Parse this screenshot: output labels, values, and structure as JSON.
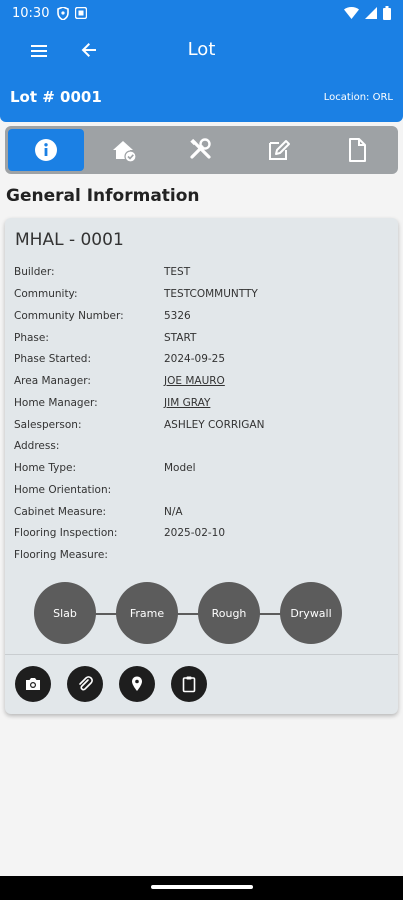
{
  "status_bar": {
    "time": "10:30"
  },
  "app_bar": {
    "title": "Lot"
  },
  "lot_header": {
    "lot_number": "Lot # 0001",
    "location": "Location: ORL"
  },
  "tabs": [
    {
      "icon": "info-icon",
      "active": true
    },
    {
      "icon": "home-check-icon",
      "active": false
    },
    {
      "icon": "tools-icon",
      "active": false
    },
    {
      "icon": "edit-icon",
      "active": false
    },
    {
      "icon": "document-icon",
      "active": false
    }
  ],
  "section": {
    "title": "General Information"
  },
  "card": {
    "title": "MHAL - 0001",
    "rows": [
      {
        "label": "Builder:",
        "value": "TEST"
      },
      {
        "label": "Community:",
        "value": "TESTCOMMUNTTY"
      },
      {
        "label": "Community Number:",
        "value": "5326"
      },
      {
        "label": "Phase:",
        "value": "START"
      },
      {
        "label": "Phase Started:",
        "value": "2024-09-25"
      },
      {
        "label": "Area Manager:",
        "value": "JOE MAURO"
      },
      {
        "label": "Home Manager:",
        "value": "JIM GRAY"
      },
      {
        "label": "Salesperson:",
        "value": "ASHLEY CORRIGAN"
      },
      {
        "label": "Address:",
        "value": ""
      },
      {
        "label": "Home Type:",
        "value": "Model"
      },
      {
        "label": "Home Orientation:",
        "value": ""
      },
      {
        "label": "Cabinet Measure:",
        "value": "N/A"
      },
      {
        "label": "Flooring Inspection:",
        "value": "2025-02-10"
      },
      {
        "label": "Flooring Measure:",
        "value": ""
      }
    ],
    "stages": [
      "Slab",
      "Frame",
      "Rough",
      "Drywall"
    ],
    "actions": [
      "camera-icon",
      "paperclip-icon",
      "location-pin-icon",
      "clipboard-icon"
    ]
  },
  "colors": {
    "primary": "#1b80e4",
    "card_bg": "#e2e7ea",
    "stage_circle": "#5c5c5c",
    "tab_bg": "#9ea2a5"
  }
}
